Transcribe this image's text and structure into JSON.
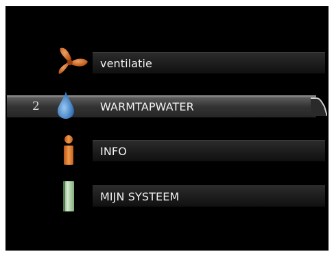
{
  "menu": {
    "items": [
      {
        "label": "ventilatie",
        "icon": "fan-icon",
        "selected": false
      },
      {
        "label": "WARMTAPWATER",
        "icon": "water-drop-icon",
        "selected": true,
        "number": "2"
      },
      {
        "label": "INFO",
        "icon": "info-icon",
        "selected": false
      },
      {
        "label": "MIJN SYSTEEM",
        "icon": "system-unit-icon",
        "selected": false
      }
    ]
  },
  "colors": {
    "background": "#000000",
    "fan_orange": "#d9661f",
    "drop_blue": "#4a86c8",
    "info_orange": "#e0731f",
    "system_green": "#8fbf8a"
  }
}
